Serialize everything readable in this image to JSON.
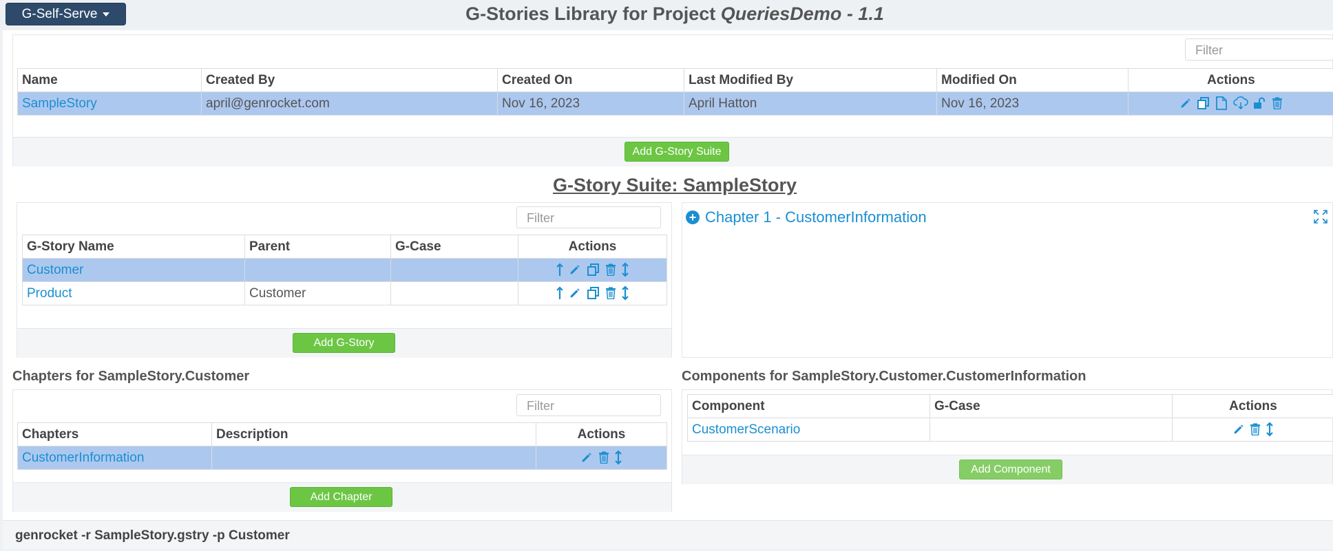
{
  "header": {
    "menu_button": "G-Self-Serve",
    "title_prefix": "G-Stories Library for Project ",
    "title_project": "QueriesDemo - 1.1"
  },
  "library": {
    "filter_placeholder": "Filter",
    "columns": [
      "Name",
      "Created By",
      "Created On",
      "Last Modified By",
      "Modified On",
      "Actions"
    ],
    "rows": [
      {
        "name": "SampleStory",
        "created_by": "april@genrocket.com",
        "created_on": "Nov 16, 2023",
        "last_modified_by": "April Hatton",
        "modified_on": "Nov 16, 2023"
      }
    ],
    "row_action_icons": [
      "pencil-icon",
      "copy-icon",
      "document-icon",
      "cloud-download-icon",
      "unlock-icon",
      "trash-icon"
    ],
    "add_button": "Add G-Story Suite"
  },
  "suite": {
    "title": "G-Story Suite: SampleStory",
    "filter_placeholder": "Filter",
    "columns": [
      "G-Story Name",
      "Parent",
      "G-Case",
      "Actions"
    ],
    "rows": [
      {
        "name": "Customer",
        "parent": "",
        "gcase": ""
      },
      {
        "name": "Product",
        "parent": "Customer",
        "gcase": ""
      }
    ],
    "row_action_icons": [
      "arrow-up-icon",
      "pencil-icon",
      "copy-icon",
      "trash-icon",
      "move-vertical-icon"
    ],
    "add_button": "Add G-Story"
  },
  "chapter_view": {
    "heading": "Chapter 1 - CustomerInformation"
  },
  "chapters": {
    "label": "Chapters for SampleStory.Customer",
    "filter_placeholder": "Filter",
    "columns": [
      "Chapters",
      "Description",
      "Actions"
    ],
    "rows": [
      {
        "name": "CustomerInformation",
        "description": ""
      }
    ],
    "row_action_icons": [
      "pencil-icon",
      "trash-icon",
      "move-vertical-icon"
    ],
    "add_button": "Add Chapter"
  },
  "components": {
    "label": "Components for SampleStory.Customer.CustomerInformation",
    "columns": [
      "Component",
      "G-Case",
      "Actions"
    ],
    "rows": [
      {
        "name": "CustomerScenario",
        "gcase": ""
      }
    ],
    "row_action_icons": [
      "pencil-icon",
      "trash-icon",
      "move-vertical-icon"
    ],
    "add_button": "Add Component"
  },
  "command": "genrocket -r SampleStory.gstry -p Customer",
  "colors": {
    "accent": "#1a8fd1",
    "selected_row": "#adc8ef",
    "green_button": "#6cc644",
    "menu_button": "#2e4a6b"
  }
}
